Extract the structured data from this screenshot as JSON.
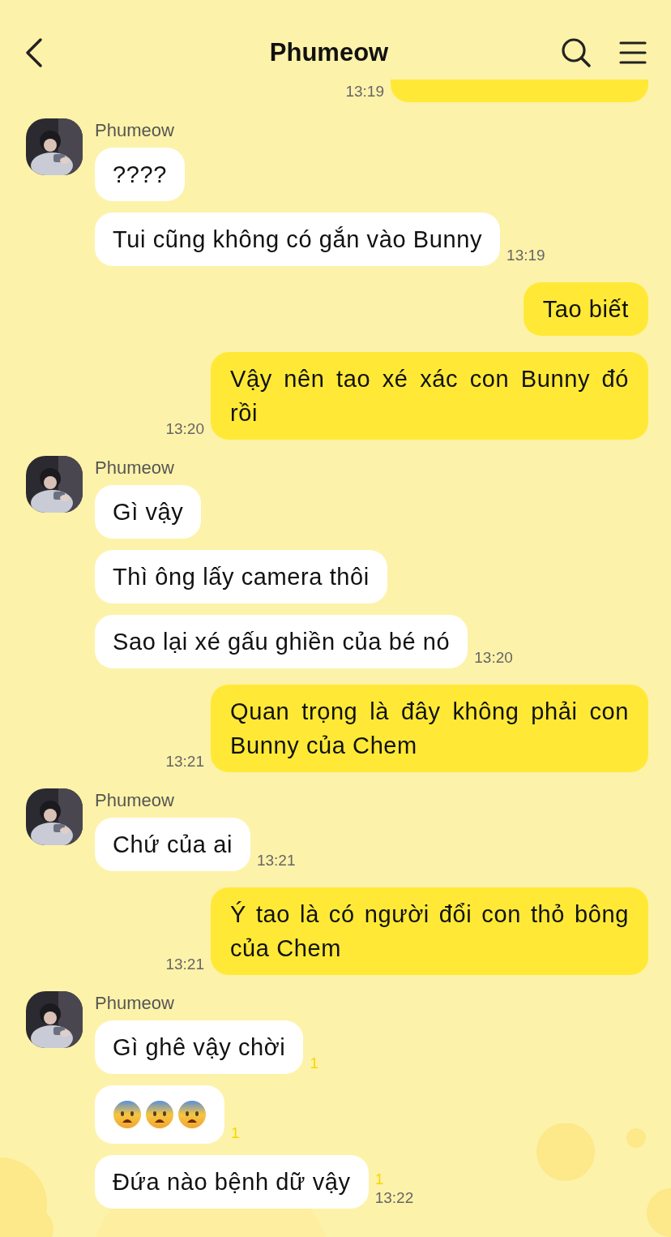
{
  "header": {
    "title": "Phumeow"
  },
  "items": [
    {
      "kind": "outgoing",
      "time": "13:19",
      "partial": true
    },
    {
      "kind": "incoming",
      "sender": "Phumeow",
      "messages": [
        {
          "kind": "text",
          "text": "????"
        },
        {
          "kind": "text",
          "text": "Tui cũng không có gắn vào Bunny",
          "time": "13:19"
        }
      ]
    },
    {
      "kind": "outgoing",
      "text": "Tao biết"
    },
    {
      "kind": "outgoing",
      "text": "Vậy nên tao xé xác con Bunny đó rồi",
      "time": "13:20"
    },
    {
      "kind": "incoming",
      "sender": "Phumeow",
      "messages": [
        {
          "kind": "text",
          "text": "Gì vậy"
        },
        {
          "kind": "text",
          "text": "Thì ông lấy camera thôi"
        },
        {
          "kind": "text",
          "text": "Sao lại xé gấu ghiền của bé nó",
          "time": "13:20"
        }
      ]
    },
    {
      "kind": "outgoing",
      "text": "Quan trọng là đây không phải con Bunny của Chem",
      "time": "13:21"
    },
    {
      "kind": "incoming",
      "sender": "Phumeow",
      "messages": [
        {
          "kind": "text",
          "text": "Chứ của ai",
          "time": "13:21"
        }
      ]
    },
    {
      "kind": "outgoing",
      "text": "Ý tao là có người đổi con thỏ bông của Chem",
      "time": "13:21"
    },
    {
      "kind": "incoming",
      "sender": "Phumeow",
      "messages": [
        {
          "kind": "text",
          "text": "Gì ghê vậy chời",
          "unread": "1"
        },
        {
          "kind": "emoji",
          "unread": "1"
        },
        {
          "kind": "text",
          "text": "Đứa nào bệnh dữ vậy",
          "unread": "1",
          "time": "13:22"
        }
      ]
    }
  ]
}
